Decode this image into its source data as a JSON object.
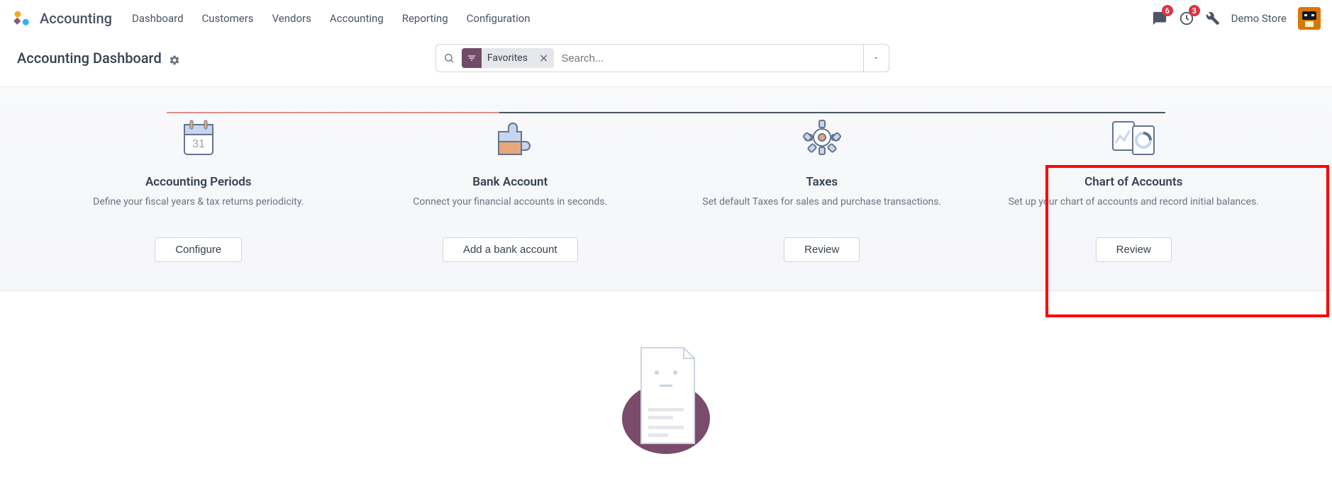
{
  "header": {
    "app_title": "Accounting",
    "nav": [
      "Dashboard",
      "Customers",
      "Vendors",
      "Accounting",
      "Reporting",
      "Configuration"
    ],
    "messages_badge": "6",
    "activities_badge": "3",
    "user_name": "Demo Store"
  },
  "subheader": {
    "page_title": "Accounting Dashboard"
  },
  "search": {
    "filter_label": "Favorites",
    "placeholder": "Search..."
  },
  "onboarding": {
    "steps": [
      {
        "title": "Accounting Periods",
        "desc": "Define your fiscal years & tax returns periodicity.",
        "button": "Configure"
      },
      {
        "title": "Bank Account",
        "desc": "Connect your financial accounts in seconds.",
        "button": "Add a bank account"
      },
      {
        "title": "Taxes",
        "desc": "Set default Taxes for sales and purchase transactions.",
        "button": "Review"
      },
      {
        "title": "Chart of Accounts",
        "desc": "Set up your chart of accounts and record initial balances.",
        "button": "Review"
      }
    ]
  }
}
